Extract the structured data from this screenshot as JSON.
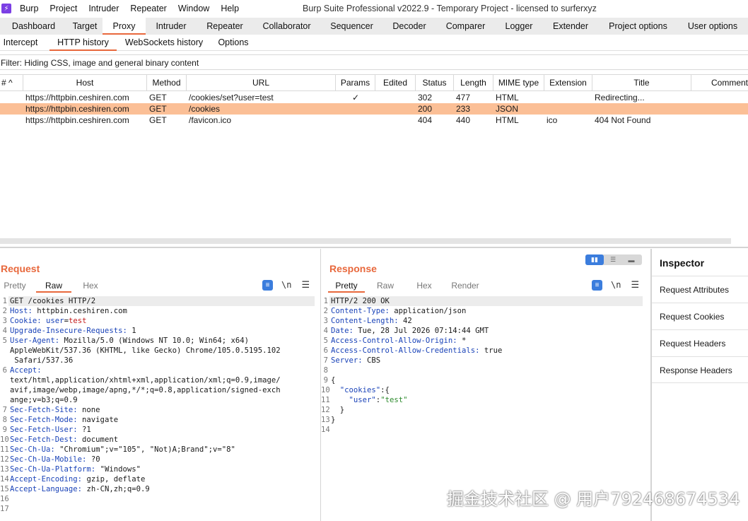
{
  "menubar": {
    "items": [
      "Burp",
      "Project",
      "Intruder",
      "Repeater",
      "Window",
      "Help"
    ],
    "window_title": "Burp Suite Professional v2022.9 - Temporary Project - licensed to surferxyz"
  },
  "top_tabs": [
    "Dashboard",
    "Target",
    "Proxy",
    "Intruder",
    "Repeater",
    "Collaborator",
    "Sequencer",
    "Decoder",
    "Comparer",
    "Logger",
    "Extender",
    "Project options",
    "User options"
  ],
  "active_top_tab": "Proxy",
  "sub_tabs": [
    "Intercept",
    "HTTP history",
    "WebSockets history",
    "Options"
  ],
  "active_sub_tab": "HTTP history",
  "filter": "Filter: Hiding CSS, image and general binary content",
  "history": {
    "columns": [
      "#",
      "Host",
      "Method",
      "URL",
      "Params",
      "Edited",
      "Status",
      "Length",
      "MIME type",
      "Extension",
      "Title",
      "Comment"
    ],
    "rows": [
      {
        "host": "https://httpbin.ceshiren.com",
        "method": "GET",
        "url": "/cookies/set?user=test",
        "params": "✓",
        "edited": "",
        "status": "302",
        "length": "477",
        "mime": "HTML",
        "ext": "",
        "title": "Redirecting...",
        "comment": "",
        "selected": false
      },
      {
        "host": "https://httpbin.ceshiren.com",
        "method": "GET",
        "url": "/cookies",
        "params": "",
        "edited": "",
        "status": "200",
        "length": "233",
        "mime": "JSON",
        "ext": "",
        "title": "",
        "comment": "",
        "selected": true
      },
      {
        "host": "https://httpbin.ceshiren.com",
        "method": "GET",
        "url": "/favicon.ico",
        "params": "",
        "edited": "",
        "status": "404",
        "length": "440",
        "mime": "HTML",
        "ext": "ico",
        "title": "404 Not Found",
        "comment": "",
        "selected": false
      }
    ]
  },
  "request": {
    "title": "Request",
    "tabs": [
      "Pretty",
      "Raw",
      "Hex"
    ],
    "active_tab": "Raw",
    "newline_label": "\\n",
    "lines": [
      {
        "n": "1",
        "parts": [
          {
            "t": "GET /cookies HTTP/2",
            "c": ""
          }
        ]
      },
      {
        "n": "2",
        "parts": [
          {
            "t": "Host:",
            "c": "k"
          },
          {
            "t": " httpbin.ceshiren.com",
            "c": ""
          }
        ]
      },
      {
        "n": "3",
        "parts": [
          {
            "t": "Cookie:",
            "c": "k"
          },
          {
            "t": " ",
            "c": ""
          },
          {
            "t": "user",
            "c": "k"
          },
          {
            "t": "=",
            "c": ""
          },
          {
            "t": "test",
            "c": "rv"
          }
        ]
      },
      {
        "n": "4",
        "parts": [
          {
            "t": "Upgrade-Insecure-Requests:",
            "c": "k"
          },
          {
            "t": " 1",
            "c": ""
          }
        ]
      },
      {
        "n": "5",
        "parts": [
          {
            "t": "User-Agent:",
            "c": "k"
          },
          {
            "t": " Mozilla/5.0 (Windows NT 10.0; Win64; x64)",
            "c": ""
          }
        ]
      },
      {
        "n": "",
        "parts": [
          {
            "t": "AppleWebKit/537.36 (KHTML, like Gecko) Chrome/105.0.5195.102",
            "c": ""
          }
        ]
      },
      {
        "n": "",
        "parts": [
          {
            "t": " Safari/537.36",
            "c": ""
          }
        ]
      },
      {
        "n": "6",
        "parts": [
          {
            "t": "Accept:",
            "c": "k"
          }
        ]
      },
      {
        "n": "",
        "parts": [
          {
            "t": "text/html,application/xhtml+xml,application/xml;q=0.9,image/",
            "c": ""
          }
        ]
      },
      {
        "n": "",
        "parts": [
          {
            "t": "avif,image/webp,image/apng,*/*;q=0.8,application/signed-exch",
            "c": ""
          }
        ]
      },
      {
        "n": "",
        "parts": [
          {
            "t": "ange;v=b3;q=0.9",
            "c": ""
          }
        ]
      },
      {
        "n": "7",
        "parts": [
          {
            "t": "Sec-Fetch-Site:",
            "c": "k"
          },
          {
            "t": " none",
            "c": ""
          }
        ]
      },
      {
        "n": "8",
        "parts": [
          {
            "t": "Sec-Fetch-Mode:",
            "c": "k"
          },
          {
            "t": " navigate",
            "c": ""
          }
        ]
      },
      {
        "n": "9",
        "parts": [
          {
            "t": "Sec-Fetch-User:",
            "c": "k"
          },
          {
            "t": " ?1",
            "c": ""
          }
        ]
      },
      {
        "n": "10",
        "parts": [
          {
            "t": "Sec-Fetch-Dest:",
            "c": "k"
          },
          {
            "t": " document",
            "c": ""
          }
        ]
      },
      {
        "n": "11",
        "parts": [
          {
            "t": "Sec-Ch-Ua:",
            "c": "k"
          },
          {
            "t": " \"Chromium\";v=\"105\", \"Not)A;Brand\";v=\"8\"",
            "c": ""
          }
        ]
      },
      {
        "n": "12",
        "parts": [
          {
            "t": "Sec-Ch-Ua-Mobile:",
            "c": "k"
          },
          {
            "t": " ?0",
            "c": ""
          }
        ]
      },
      {
        "n": "13",
        "parts": [
          {
            "t": "Sec-Ch-Ua-Platform:",
            "c": "k"
          },
          {
            "t": " \"Windows\"",
            "c": ""
          }
        ]
      },
      {
        "n": "14",
        "parts": [
          {
            "t": "Accept-Encoding:",
            "c": "k"
          },
          {
            "t": " gzip, deflate",
            "c": ""
          }
        ]
      },
      {
        "n": "15",
        "parts": [
          {
            "t": "Accept-Language:",
            "c": "k"
          },
          {
            "t": " zh-CN,zh;q=0.9",
            "c": ""
          }
        ]
      },
      {
        "n": "16",
        "parts": [
          {
            "t": "",
            "c": ""
          }
        ]
      },
      {
        "n": "17",
        "parts": [
          {
            "t": "",
            "c": ""
          }
        ]
      }
    ]
  },
  "response": {
    "title": "Response",
    "tabs": [
      "Pretty",
      "Raw",
      "Hex",
      "Render"
    ],
    "active_tab": "Pretty",
    "newline_label": "\\n",
    "lines": [
      {
        "n": "1",
        "parts": [
          {
            "t": "HTTP/2 200 OK",
            "c": ""
          }
        ]
      },
      {
        "n": "2",
        "parts": [
          {
            "t": "Content-Type:",
            "c": "k"
          },
          {
            "t": " application/json",
            "c": ""
          }
        ]
      },
      {
        "n": "3",
        "parts": [
          {
            "t": "Content-Length:",
            "c": "k"
          },
          {
            "t": " 42",
            "c": ""
          }
        ]
      },
      {
        "n": "4",
        "parts": [
          {
            "t": "Date:",
            "c": "k"
          },
          {
            "t": " Tue, 28 Jul 2026 07:14:44 GMT",
            "c": ""
          }
        ]
      },
      {
        "n": "5",
        "parts": [
          {
            "t": "Access-Control-Allow-Origin:",
            "c": "k"
          },
          {
            "t": " *",
            "c": ""
          }
        ]
      },
      {
        "n": "6",
        "parts": [
          {
            "t": "Access-Control-Allow-Credentials:",
            "c": "k"
          },
          {
            "t": " true",
            "c": ""
          }
        ]
      },
      {
        "n": "7",
        "parts": [
          {
            "t": "Server:",
            "c": "k"
          },
          {
            "t": " CBS",
            "c": ""
          }
        ]
      },
      {
        "n": "8",
        "parts": [
          {
            "t": "",
            "c": ""
          }
        ]
      },
      {
        "n": "9",
        "parts": [
          {
            "t": "{",
            "c": ""
          }
        ]
      },
      {
        "n": "10",
        "parts": [
          {
            "t": "  ",
            "c": ""
          },
          {
            "t": "\"cookies\"",
            "c": "k"
          },
          {
            "t": ":{",
            "c": ""
          }
        ]
      },
      {
        "n": "11",
        "parts": [
          {
            "t": "    ",
            "c": ""
          },
          {
            "t": "\"user\"",
            "c": "k"
          },
          {
            "t": ":",
            "c": ""
          },
          {
            "t": "\"test\"",
            "c": "str"
          }
        ]
      },
      {
        "n": "12",
        "parts": [
          {
            "t": "  }",
            "c": ""
          }
        ]
      },
      {
        "n": "13",
        "parts": [
          {
            "t": "}",
            "c": ""
          }
        ]
      },
      {
        "n": "14",
        "parts": [
          {
            "t": "",
            "c": ""
          }
        ]
      }
    ]
  },
  "inspector": {
    "title": "Inspector",
    "items": [
      "Request Attributes",
      "Request Cookies",
      "Request Headers",
      "Response Headers"
    ]
  },
  "watermark": "掘金技术社区 @ 用户792468674534",
  "colors": {
    "accent": "#e8683c",
    "selected_row": "#fbbf96",
    "header_key": "#1a43b8",
    "button_blue": "#3b7ddd"
  }
}
